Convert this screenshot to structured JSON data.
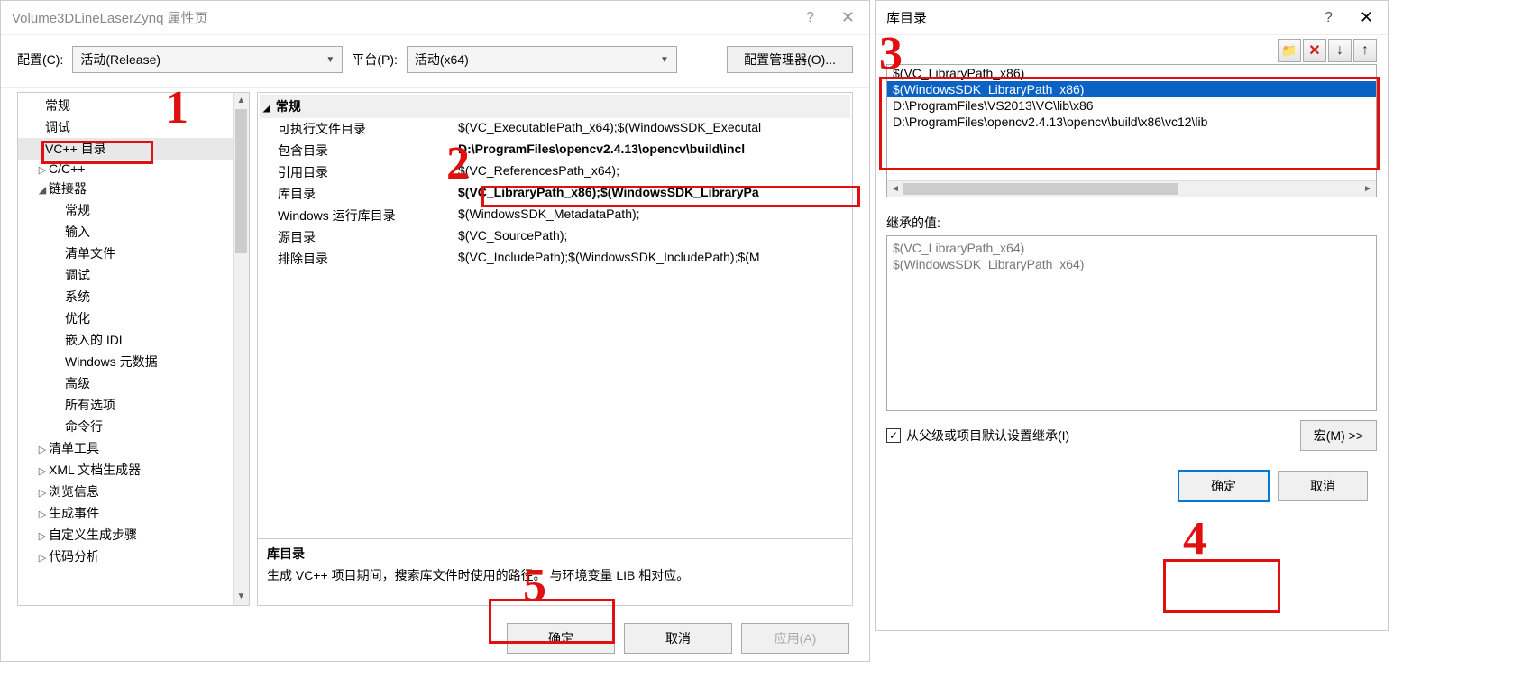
{
  "leftDialog": {
    "title": "Volume3DLineLaserZynq 属性页",
    "configLabel": "配置(C):",
    "configValue": "活动(Release)",
    "platformLabel": "平台(P):",
    "platformValue": "活动(x64)",
    "configMgr": "配置管理器(O)...",
    "tree": {
      "items": [
        "常规",
        "调试",
        "VC++ 目录",
        "C/C++",
        "链接器",
        "常规",
        "输入",
        "清单文件",
        "调试",
        "系统",
        "优化",
        "嵌入的 IDL",
        "Windows 元数据",
        "高级",
        "所有选项",
        "命令行",
        "清单工具",
        "XML 文档生成器",
        "浏览信息",
        "生成事件",
        "自定义生成步骤",
        "代码分析"
      ]
    },
    "category": "常规",
    "props": [
      {
        "name": "可执行文件目录",
        "val": "$(VC_ExecutablePath_x64);$(WindowsSDK_Executal",
        "bold": false
      },
      {
        "name": "包含目录",
        "val": "D:\\ProgramFiles\\opencv2.4.13\\opencv\\build\\incl",
        "bold": true
      },
      {
        "name": "引用目录",
        "val": "$(VC_ReferencesPath_x64);",
        "bold": false
      },
      {
        "name": "库目录",
        "val": "$(VC_LibraryPath_x86);$(WindowsSDK_LibraryPa",
        "bold": true
      },
      {
        "name": "Windows 运行库目录",
        "val": "$(WindowsSDK_MetadataPath);",
        "bold": false
      },
      {
        "name": "源目录",
        "val": "$(VC_SourcePath);",
        "bold": false
      },
      {
        "name": "排除目录",
        "val": "$(VC_IncludePath);$(WindowsSDK_IncludePath);$(M",
        "bold": false
      }
    ],
    "descTitle": "库目录",
    "descText": "生成 VC++ 项目期间，搜索库文件时使用的路径。  与环境变量 LIB 相对应。",
    "btnOk": "确定",
    "btnCancel": "取消",
    "btnApply": "应用(A)"
  },
  "rightDialog": {
    "title": "库目录",
    "listItems": [
      "$(VC_LibraryPath_x86)",
      "$(WindowsSDK_LibraryPath_x86)",
      "D:\\ProgramFiles\\VS2013\\VC\\lib\\x86",
      "D:\\ProgramFiles\\opencv2.4.13\\opencv\\build\\x86\\vc12\\lib"
    ],
    "inheritLabel": "继承的值:",
    "inheritItems": [
      "$(VC_LibraryPath_x64)",
      "$(WindowsSDK_LibraryPath_x64)"
    ],
    "checkboxLabel": "从父级或项目默认设置继承(I)",
    "macroBtn": "宏(M) >>",
    "btnOk": "确定",
    "btnCancel": "取消"
  },
  "annotations": {
    "m1": "1",
    "m2": "2",
    "m3": "3",
    "m4": "4",
    "m5": "5"
  }
}
